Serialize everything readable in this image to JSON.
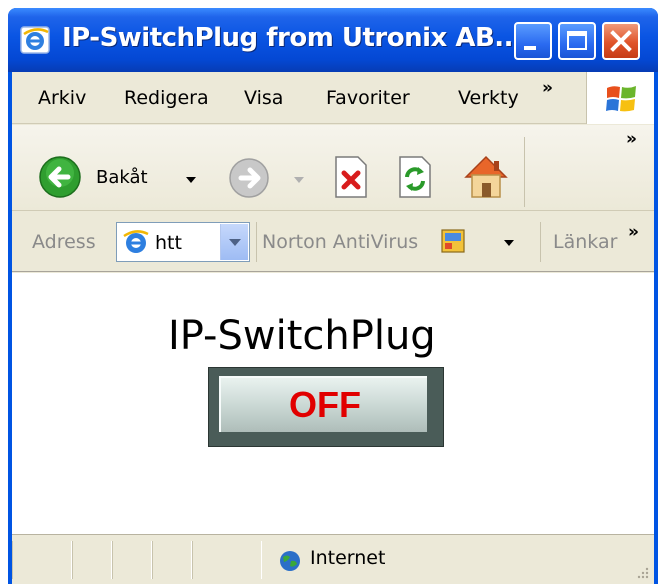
{
  "window": {
    "title": "IP-SwitchPlug from Utronix AB..."
  },
  "menubar": {
    "items": [
      {
        "label": "Arkiv"
      },
      {
        "label": "Redigera"
      },
      {
        "label": "Visa"
      },
      {
        "label": "Favoriter"
      },
      {
        "label": "Verkty"
      }
    ],
    "overflow": "»"
  },
  "toolbar": {
    "back_label": "Bakåt",
    "overflow": "»"
  },
  "addressbar": {
    "label": "Adress",
    "value": "htt",
    "norton_label": "Norton AntiVirus",
    "links_label": "Länkar",
    "overflow": "»"
  },
  "page": {
    "title": "IP-SwitchPlug",
    "switch_label": "OFF"
  },
  "statusbar": {
    "zone": "Internet"
  },
  "colors": {
    "titlebar": "#0a55e3",
    "off_text": "#e10000",
    "chrome": "#ece9d8"
  }
}
